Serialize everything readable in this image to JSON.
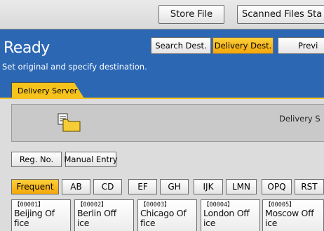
{
  "toolbar": {
    "store_file_label": "Store File",
    "scanned_files_status_label": "Scanned Files Sta"
  },
  "header": {
    "status": "Ready",
    "instruction": "Set original and specify destination.",
    "search_dest_label": "Search Dest.",
    "delivery_dest_label": "Delivery Dest.",
    "preview_label": "Previ"
  },
  "tabs": [
    {
      "label": "Delivery Server",
      "selected": true
    }
  ],
  "server_panel": {
    "label": "Delivery S",
    "icon": "folder-icon"
  },
  "entry_buttons": {
    "reg_no_label": "Reg. No.",
    "manual_entry_label": "Manual Entry"
  },
  "index_tabs": [
    {
      "label": "Frequent",
      "selected": true
    },
    {
      "label": "AB"
    },
    {
      "label": "CD"
    },
    {
      "label": "EF"
    },
    {
      "label": "GH"
    },
    {
      "label": "IJK"
    },
    {
      "label": "LMN"
    },
    {
      "label": "OPQ"
    },
    {
      "label": "RST"
    }
  ],
  "destinations": [
    {
      "number": "【00001】",
      "name": "Beijing Of",
      "name2": "fice"
    },
    {
      "number": "【00002】",
      "name": "Berlin Off",
      "name2": "ice"
    },
    {
      "number": "【00003】",
      "name": "Chicago Of",
      "name2": "fice"
    },
    {
      "number": "【00004】",
      "name": "London Off",
      "name2": "ice"
    },
    {
      "number": "【00005】",
      "name": "Moscow Off",
      "name2": "ice"
    }
  ],
  "colors": {
    "header_blue": "#2c67b4",
    "selected_yellow": "#f6c31d"
  }
}
